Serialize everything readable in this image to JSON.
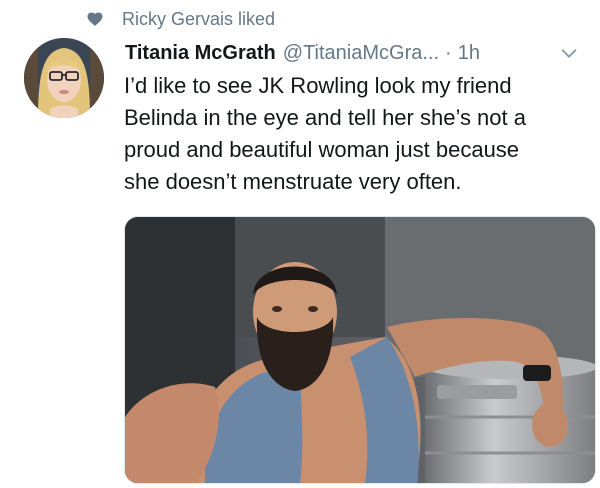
{
  "social_context": {
    "icon": "heart-icon",
    "text": "Ricky Gervais liked"
  },
  "tweet": {
    "display_name": "Titania McGrath",
    "handle": "@TitaniaMcGra...",
    "separator": "·",
    "time": "1h",
    "text": "I’d like to see JK Rowling look my friend\nBelinda in the eye and tell her she’s not a\nproud and beautiful woman just because\nshe doesn’t menstruate very often.",
    "menu_icon": "chevron-down-icon",
    "media_alt": "photo"
  },
  "colors": {
    "text_primary": "#14171a",
    "text_secondary": "#657786",
    "border": "#e1e8ed"
  }
}
